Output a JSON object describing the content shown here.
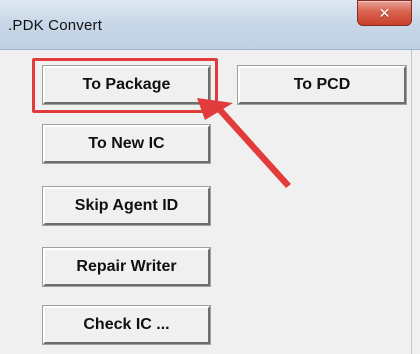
{
  "window": {
    "title": ".PDK Convert",
    "close_glyph": "✕"
  },
  "buttons": {
    "to_package": "To Package",
    "to_pcd": "To PCD",
    "to_new_ic": "To New IC",
    "skip_agent_id": "Skip Agent ID",
    "repair_writer": "Repair Writer",
    "check_ic": "Check IC ..."
  },
  "annotation": {
    "highlight_color": "#e23b3b",
    "arrow_color": "#e23b3b"
  },
  "icons": {
    "close": "close-icon"
  }
}
